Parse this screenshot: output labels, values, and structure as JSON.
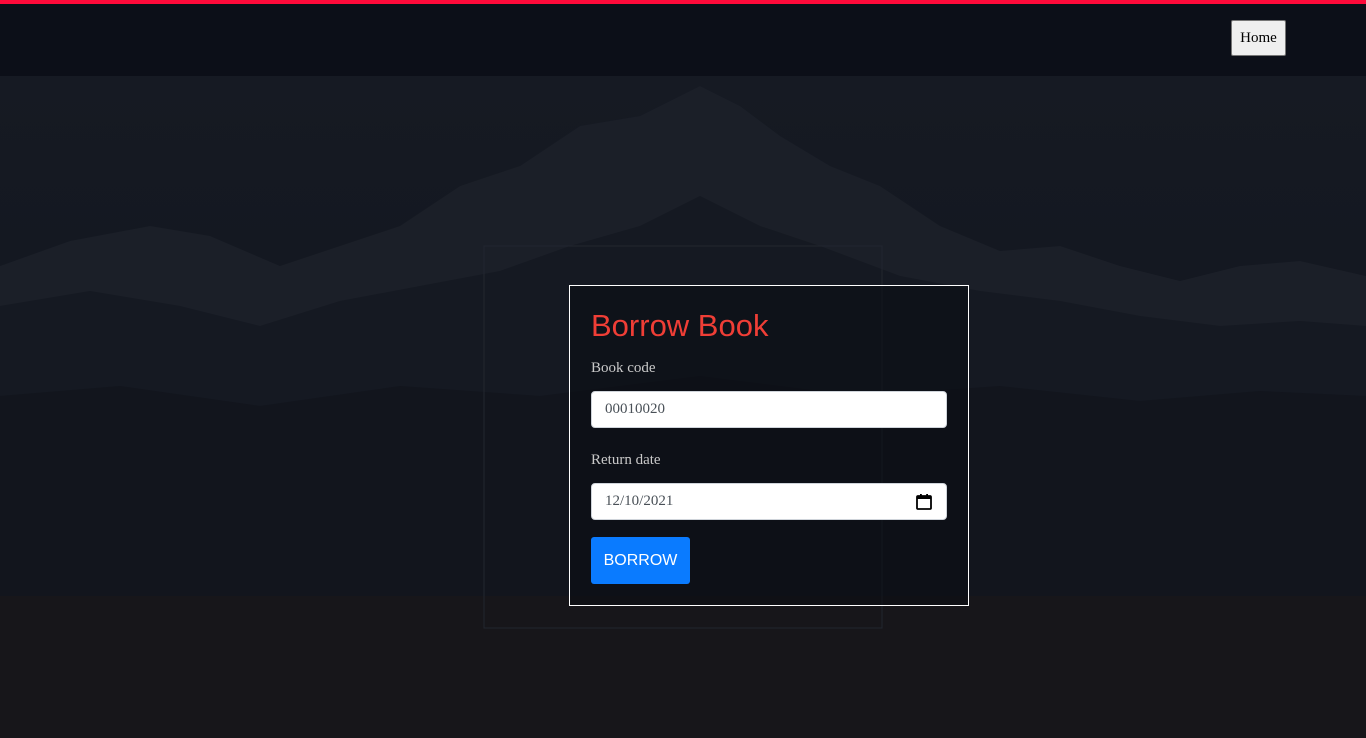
{
  "colors": {
    "accent_stripe": "#ff0a3a",
    "title": "#ef3e36",
    "primary_button": "#0a7bff"
  },
  "nav": {
    "home_label": "Home"
  },
  "form": {
    "title": "Borrow Book",
    "book_code": {
      "label": "Book code",
      "value": "00010020"
    },
    "return_date": {
      "label": "Return date",
      "value": "12/10/2021",
      "icon": "calendar-icon"
    },
    "submit_label": "BORROW"
  }
}
